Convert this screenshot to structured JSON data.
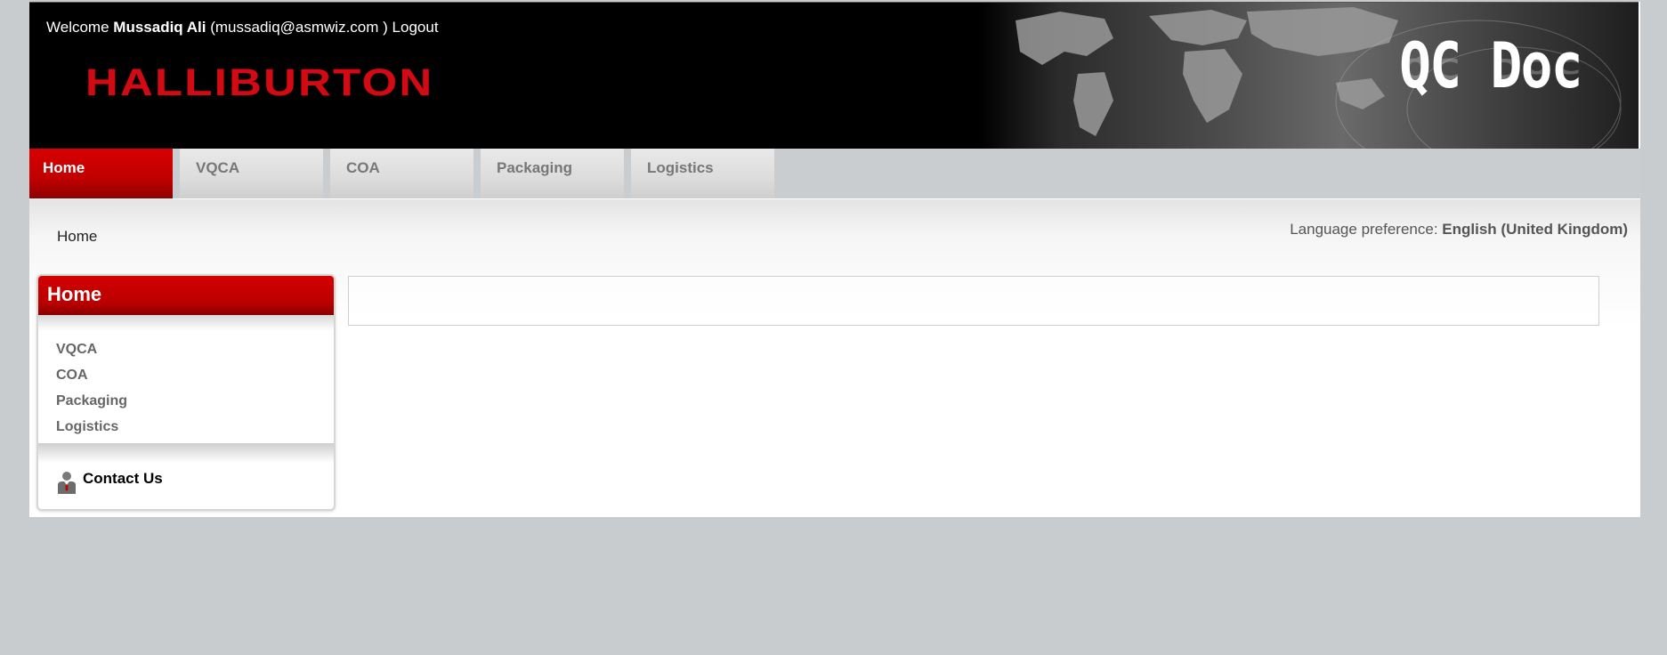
{
  "header": {
    "welcome_prefix": "Welcome",
    "user_name": "Mussadiq Ali",
    "user_email": "(mussadiq@asmwiz.com )",
    "logout_label": "Logout",
    "logo_text": "HALLIBURTON",
    "product_title": "QC Doc"
  },
  "nav": {
    "tabs": [
      {
        "label": "Home",
        "active": true
      },
      {
        "label": "VQCA"
      },
      {
        "label": "COA"
      },
      {
        "label": "Packaging"
      },
      {
        "label": "Logistics"
      }
    ]
  },
  "content": {
    "breadcrumb": "Home",
    "language_label": "Language preference:",
    "language_value": "English (United Kingdom)"
  },
  "sidebar": {
    "title": "Home",
    "items": [
      {
        "label": "VQCA"
      },
      {
        "label": "COA"
      },
      {
        "label": "Packaging"
      },
      {
        "label": "Logistics"
      }
    ],
    "contact_label": "Contact Us"
  },
  "colors": {
    "accent_red": "#c00000",
    "logo_red": "#d10a14",
    "page_bg": "#c8cccf"
  }
}
